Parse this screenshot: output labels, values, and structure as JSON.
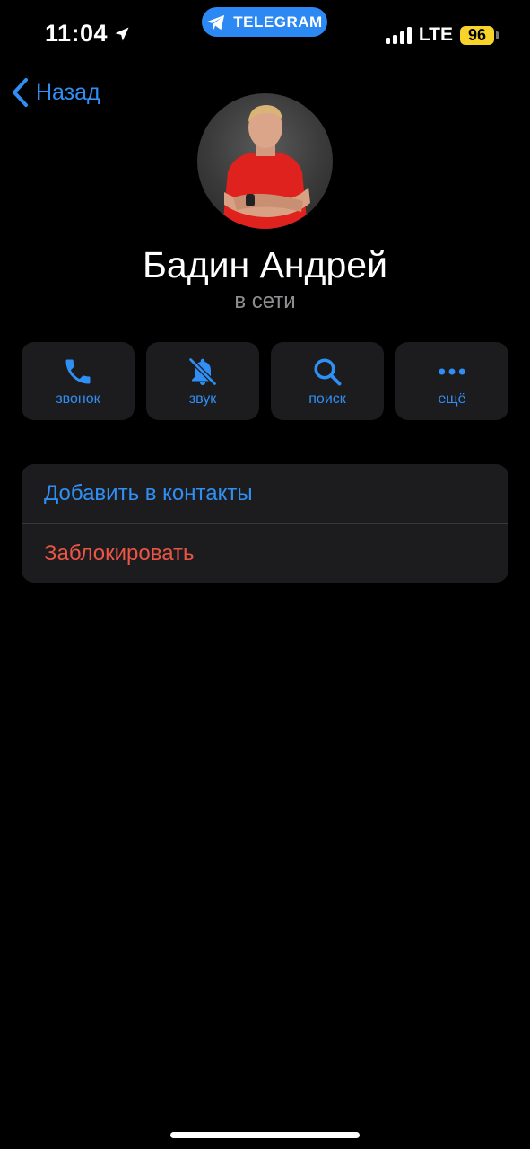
{
  "status_bar": {
    "time": "11:04",
    "app_pill": "TELEGRAM",
    "network": "LTE",
    "battery": "96",
    "battery_color": "#f8d42b",
    "pill_color": "#2c88f2"
  },
  "nav": {
    "back_label": "Назад"
  },
  "profile": {
    "name": "Бадин Андрей",
    "status": "в сети",
    "avatar_icon": "profile-photo"
  },
  "actions": [
    {
      "label": "звонок",
      "icon": "phone-icon"
    },
    {
      "label": "звук",
      "icon": "bell-slash-icon"
    },
    {
      "label": "поиск",
      "icon": "search-icon"
    },
    {
      "label": "ещё",
      "icon": "more-icon"
    }
  ],
  "menu": [
    {
      "label": "Добавить в контакты",
      "color": "#2f8ff4"
    },
    {
      "label": "Заблокировать",
      "color": "#eb5545"
    }
  ]
}
